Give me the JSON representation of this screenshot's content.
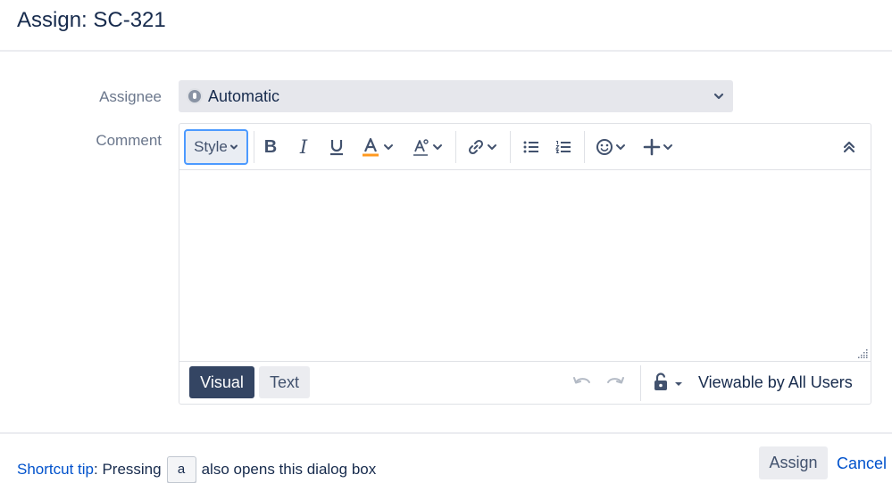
{
  "dialog": {
    "title": "Assign: SC-321"
  },
  "fields": {
    "assignee": {
      "label": "Assignee",
      "value": "Automatic"
    },
    "comment": {
      "label": "Comment"
    }
  },
  "toolbar": {
    "style_label": "Style",
    "bold_label": "B",
    "italic_label": "I",
    "buttons": [
      "bold-icon",
      "italic-icon",
      "underline-icon",
      "text-color-icon",
      "more-formatting-icon",
      "link-icon",
      "bullet-list-icon",
      "numbered-list-icon",
      "emoji-icon",
      "insert-more-icon",
      "collapse-toolbar-icon"
    ],
    "text_color_accent": "#ff991f"
  },
  "editor_footer": {
    "visual_label": "Visual",
    "text_label": "Text",
    "visibility_label": "Viewable by All Users"
  },
  "footer": {
    "tip_link": "Shortcut tip",
    "tip_prefix": ": Pressing",
    "tip_key": "a",
    "tip_suffix": "also opens this dialog box",
    "assign_label": "Assign",
    "cancel_label": "Cancel"
  },
  "colors": {
    "primary_dark": "#344563",
    "link": "#0052cc",
    "focus_ring": "#4c9aff"
  }
}
